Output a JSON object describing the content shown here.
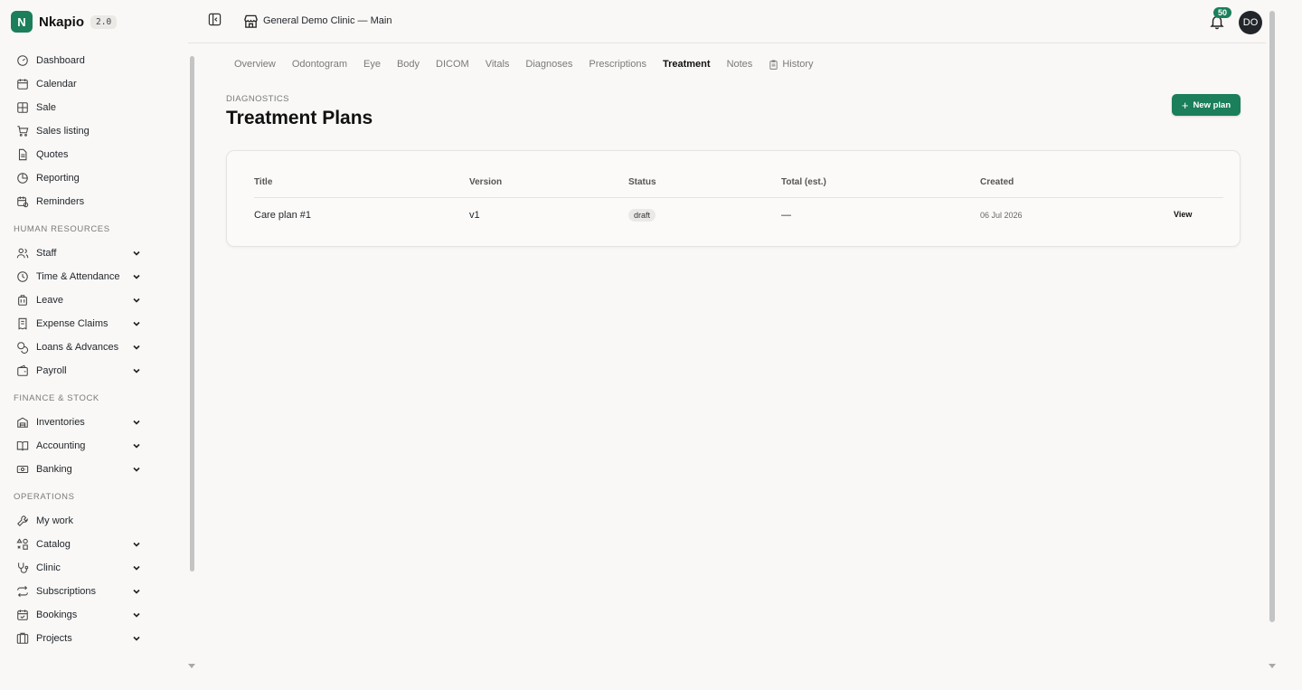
{
  "brand": {
    "name": "Nkapio",
    "version": "2.0",
    "logo_letter": "N",
    "accent": "#1a7f5a"
  },
  "sidebar": {
    "main_items": [
      {
        "label": "Dashboard",
        "icon": "gauge-icon"
      },
      {
        "label": "Calendar",
        "icon": "calendar-icon"
      },
      {
        "label": "Sale",
        "icon": "grid-icon"
      },
      {
        "label": "Sales listing",
        "icon": "cart-icon"
      },
      {
        "label": "Quotes",
        "icon": "document-icon"
      },
      {
        "label": "Reporting",
        "icon": "pie-chart-icon"
      },
      {
        "label": "Reminders",
        "icon": "calendar-clock-icon"
      }
    ],
    "sections": [
      {
        "title": "HUMAN RESOURCES",
        "items": [
          {
            "label": "Staff",
            "icon": "users-icon"
          },
          {
            "label": "Time & Attendance",
            "icon": "clock-icon"
          },
          {
            "label": "Leave",
            "icon": "luggage-icon"
          },
          {
            "label": "Expense Claims",
            "icon": "receipt-icon"
          },
          {
            "label": "Loans & Advances",
            "icon": "coins-icon"
          },
          {
            "label": "Payroll",
            "icon": "wallet-icon"
          }
        ]
      },
      {
        "title": "FINANCE & STOCK",
        "items": [
          {
            "label": "Inventories",
            "icon": "warehouse-icon"
          },
          {
            "label": "Accounting",
            "icon": "book-icon"
          },
          {
            "label": "Banking",
            "icon": "banknote-icon"
          }
        ]
      },
      {
        "title": "OPERATIONS",
        "items": [
          {
            "label": "My work",
            "icon": "wrench-icon"
          },
          {
            "label": "Catalog",
            "icon": "shapes-icon"
          },
          {
            "label": "Clinic",
            "icon": "stethoscope-icon"
          },
          {
            "label": "Subscriptions",
            "icon": "repeat-icon"
          },
          {
            "label": "Bookings",
            "icon": "calendar-check-icon"
          },
          {
            "label": "Projects",
            "icon": "folder-kanban-icon"
          }
        ]
      }
    ]
  },
  "header": {
    "clinic": "General Demo Clinic — Main",
    "notifications": "50",
    "avatar_initials": "DO"
  },
  "tabs": [
    {
      "label": "Overview",
      "active": false
    },
    {
      "label": "Odontogram",
      "active": false
    },
    {
      "label": "Eye",
      "active": false
    },
    {
      "label": "Body",
      "active": false
    },
    {
      "label": "DICOM",
      "active": false
    },
    {
      "label": "Vitals",
      "active": false
    },
    {
      "label": "Diagnoses",
      "active": false
    },
    {
      "label": "Prescriptions",
      "active": false
    },
    {
      "label": "Treatment",
      "active": true
    },
    {
      "label": "Notes",
      "active": false
    },
    {
      "label": "History",
      "active": false,
      "icon": "clipboard-icon"
    }
  ],
  "page": {
    "eyebrow": "DIAGNOSTICS",
    "title": "Treatment Plans",
    "new_button": "New plan"
  },
  "table": {
    "columns": [
      "Title",
      "Version",
      "Status",
      "Total (est.)",
      "Created"
    ],
    "rows": [
      {
        "title": "Care plan #1",
        "version": "v1",
        "status": "draft",
        "total": "—",
        "created": "06 Jul 2026",
        "action": "View"
      }
    ]
  }
}
